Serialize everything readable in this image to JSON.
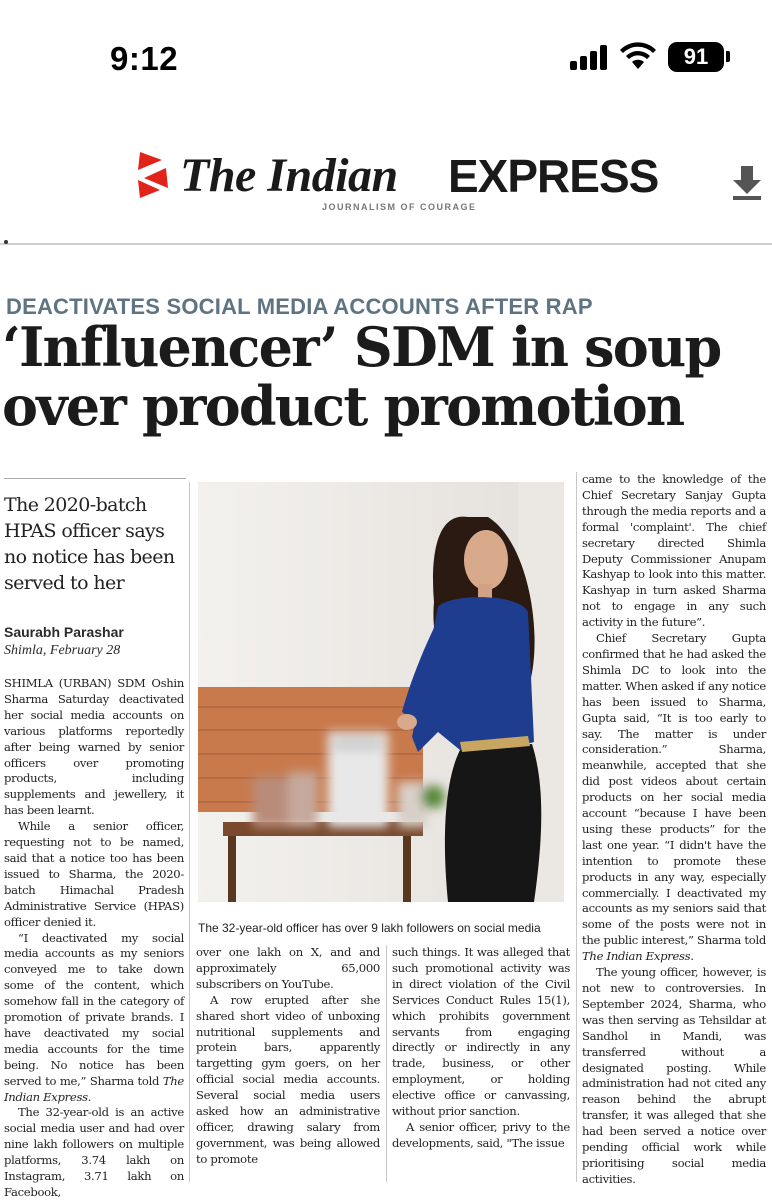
{
  "status_bar": {
    "time": "9:12",
    "battery": "91"
  },
  "masthead": {
    "title": "The Indian",
    "title_bold": "EXPRESS",
    "tagline": "JOURNALISM OF COURAGE",
    "brand_color": "#e2231a"
  },
  "article": {
    "kicker": "DEACTIVATES SOCIAL MEDIA ACCOUNTS AFTER RAP",
    "headline_line1": "‘Influencer’ SDM in soup",
    "headline_line2": "over product promotion",
    "dek": "The 2020-batch HPAS officer says no notice has been served to her",
    "byline": "Saurabh Parashar",
    "dateline": "Shimla, February 28",
    "caption": "The 32-year-old officer has over 9 lakh followers on social media",
    "col1": [
      "SHIMLA (URBAN) SDM Oshin Sharma Saturday deactivated her social media accounts on various platforms reportedly after being warned by senior officers over promoting products, including supplements and jewellery, it has been learnt.",
      "While a senior officer, requesting not to be named, said that a notice too has been issued to Sharma, the 2020-batch Himachal Pradesh Administrative Service (HPAS) officer denied it.",
      "“I deactivated my social media accounts as my seniors conveyed me to take down some of the content, which somehow fall in the category of promotion of private brands. I have deactivated my social media accounts for the time being. No notice has been served to me,” Sharma told",
      "The 32-year-old is an active social media user and had over nine lakh followers on multiple platforms, 3.74 lakh on Instagram, 3.71 lakh on Facebook,"
    ],
    "col1_italic": "The Indian Express.",
    "col2": [
      "over one lakh on X, and and approximately 65,000 subscribers on YouTube.",
      "A row erupted after she shared short video of unboxing nutritional supplements and protein bars, apparently targetting gym goers, on her official social media accounts. Several social media users asked how an administrative officer, drawing salary from government, was being allowed to promote"
    ],
    "col3": [
      "such things. It was alleged that such promotional activity was in direct violation of the Civil Services Conduct Rules 15(1), which prohibits government servants from engaging directly or indirectly in any trade, business, or other employment, or holding elective office or canvassing, without prior sanction.",
      "A senior officer, privy to the developments, said, \"The issue"
    ],
    "col4": [
      "came to the knowledge of the Chief Secretary Sanjay Gupta through the media reports and a formal 'complaint'. The chief secretary directed Shimla Deputy Commissioner Anupam Kashyap to look into this matter. Kashyap in turn asked Sharma not to engage in any such activity in the future”.",
      "Chief Secretary Gupta confirmed that he had asked the Shimla DC to look into the matter. When asked if any notice has been issued to Sharma, Gupta said, “It is too early to say. The matter is under consideration.” Sharma, meanwhile, accepted that she did post videos about certain products on her social media account “because I have been using these products” for the last one year. “I didn't have the intention to promote these products in any way, especially commercially. I deactivated my accounts as my seniors said that some of the posts were not in the public interest,” Sharma told",
      "The young officer, however, is not new to controversies. In September 2024, Sharma, who was then serving as Tehsildar at Sandhol in Mandi, was transferred without a designated posting. While administration had not cited any reason behind the abrupt transfer, it was alleged that she had been served a notice over pending official work while prioritising social media activities."
    ],
    "col4_italic": "The Indian Express."
  }
}
